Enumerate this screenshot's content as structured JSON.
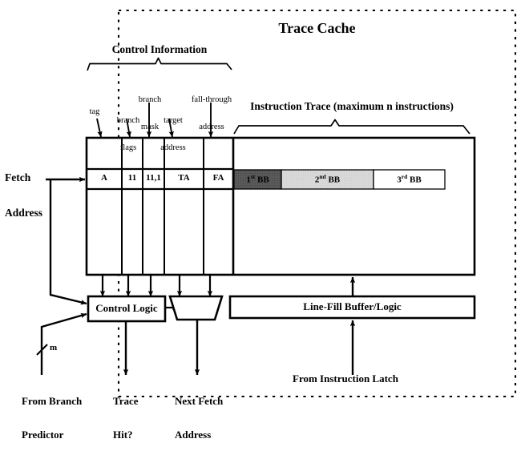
{
  "diagram": {
    "title": "Trace Cache",
    "boundary": {
      "style": "dashed",
      "color": "#000000"
    }
  },
  "braces": {
    "control_information": "Control Information",
    "instruction_trace": "Instruction Trace (maximum n instructions)"
  },
  "field_labels": [
    {
      "id": "tag",
      "text": "tag"
    },
    {
      "id": "branch-flags",
      "line1": "branch",
      "line2": "flags"
    },
    {
      "id": "branch-mask",
      "line1": "branch",
      "line2": "mask"
    },
    {
      "id": "target-address",
      "line1": "target",
      "line2": "address"
    },
    {
      "id": "fall-through-address",
      "line1": "fall-through",
      "line2": "address"
    }
  ],
  "table": {
    "columns": [
      "tag",
      "branch flags",
      "branch mask",
      "target address",
      "fall-through address"
    ],
    "row_values": {
      "tag": "A",
      "branch_flags": "11",
      "branch_mask": "11,1",
      "target_address": "TA",
      "fall_through_address": "FA"
    }
  },
  "instruction_trace": {
    "blocks": [
      {
        "label_num": "1",
        "label_sup": "st",
        "label_tail": " BB",
        "fill": "#595959",
        "text_color": "#000000"
      },
      {
        "label_num": "2",
        "label_sup": "nd",
        "label_tail": " BB",
        "fill": "#d9d9d9",
        "text_color": "#000000"
      },
      {
        "label_num": "3",
        "label_sup": "rd",
        "label_tail": " BB",
        "fill": "#ffffff",
        "text_color": "#000000"
      }
    ]
  },
  "blocks": {
    "control_logic": "Control Logic",
    "mux": "",
    "line_fill_buffer": "Line-Fill Buffer/Logic"
  },
  "io_labels": {
    "fetch_address_l1": "Fetch",
    "fetch_address_l2": "Address",
    "bus_width": "m",
    "from_branch_predictor_l1": "From Branch",
    "from_branch_predictor_l2": "Predictor",
    "trace_hit_l1": "Trace",
    "trace_hit_l2": "Hit?",
    "next_fetch_address_l1": "Next Fetch",
    "next_fetch_address_l2": "Address",
    "from_instruction_latch": "From Instruction Latch"
  }
}
